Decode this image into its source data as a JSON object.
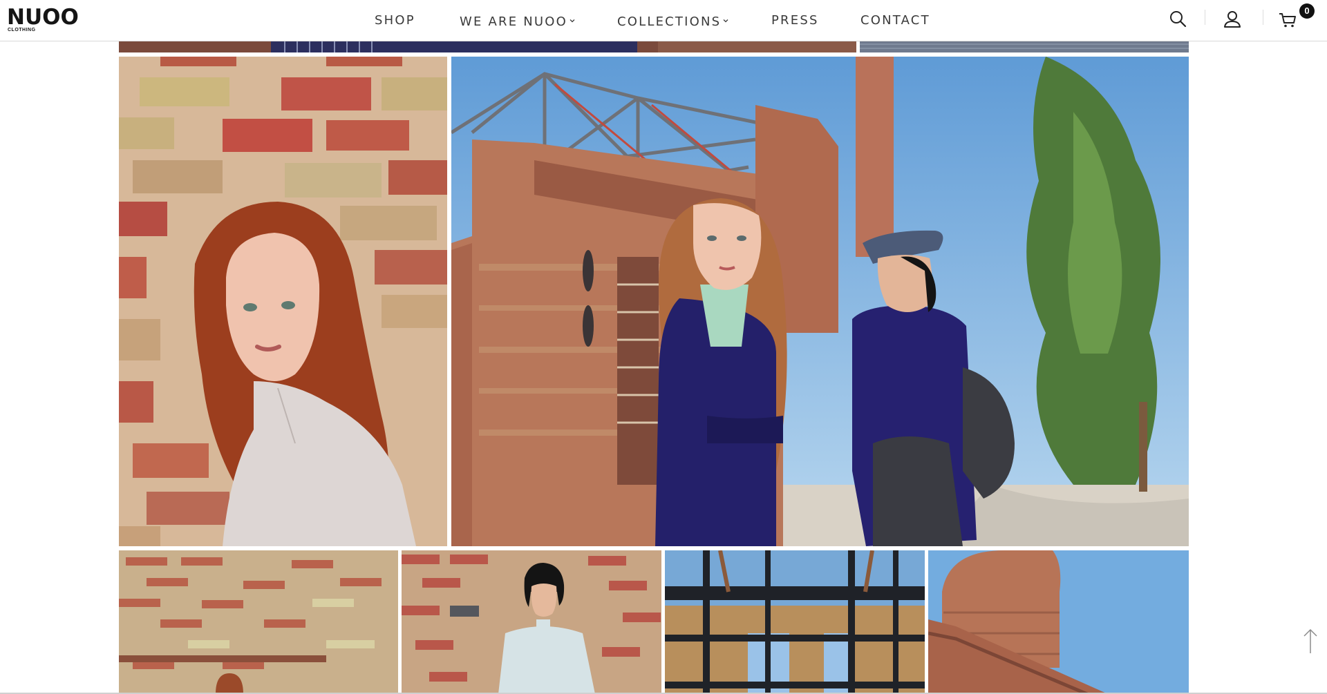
{
  "brand": {
    "name": "NUOO",
    "tagline": "CLOTHING"
  },
  "nav": {
    "items": [
      {
        "label": "SHOP",
        "has_dropdown": false
      },
      {
        "label": "WE ARE NUOO",
        "has_dropdown": true
      },
      {
        "label": "COLLECTIONS",
        "has_dropdown": true
      },
      {
        "label": "PRESS",
        "has_dropdown": false
      },
      {
        "label": "CONTACT",
        "has_dropdown": false
      }
    ]
  },
  "header_icons": {
    "search": "search-icon",
    "account": "user-icon",
    "cart": "cart-icon",
    "cart_count": "0"
  },
  "gallery": {
    "photos": [
      {
        "name": "partial-photo-navy-stripes"
      },
      {
        "name": "partial-photo-paving"
      },
      {
        "name": "model-redhead-brick-wall"
      },
      {
        "name": "two-models-brick-ruins"
      },
      {
        "name": "brick-wall-arch"
      },
      {
        "name": "model-bob-haircut-brick-wall"
      },
      {
        "name": "steel-frame-structure"
      },
      {
        "name": "brick-chimney-sky"
      }
    ]
  },
  "scroll_top": "arrow-up-icon",
  "colors": {
    "nav_text": "#3a3a3a",
    "brick": "#b76a4c",
    "sky": "#8ec0ea",
    "navy": "#24206a",
    "badge": "#111111"
  }
}
